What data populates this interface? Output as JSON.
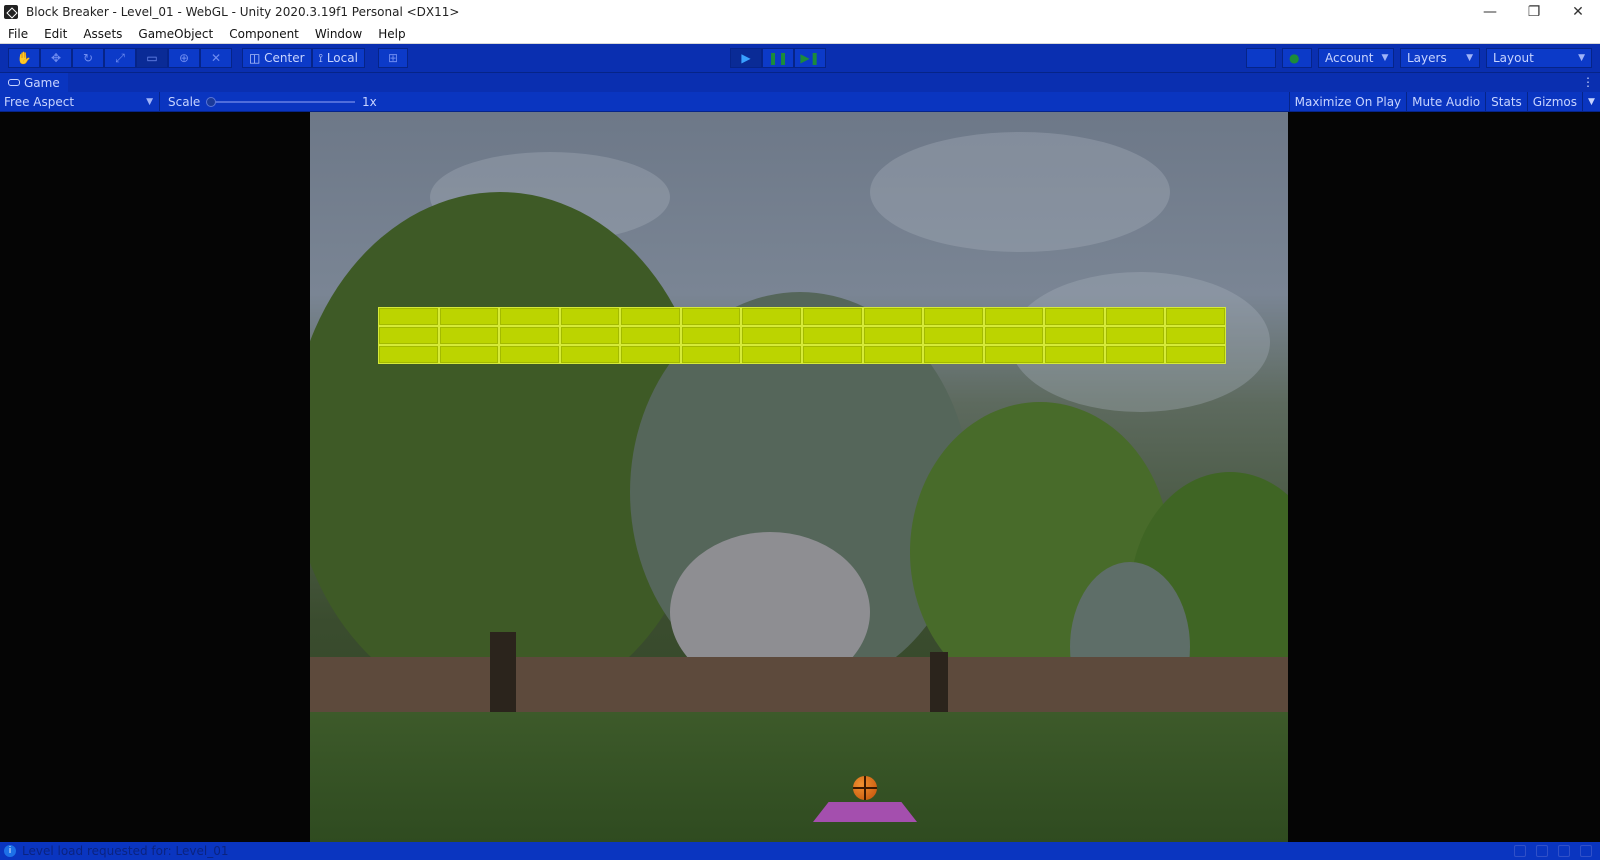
{
  "window": {
    "title": "Block Breaker - Level_01 - WebGL - Unity 2020.3.19f1 Personal <DX11>",
    "controls": [
      "—",
      "❐",
      "✕"
    ]
  },
  "menu": [
    "File",
    "Edit",
    "Assets",
    "GameObject",
    "Component",
    "Window",
    "Help"
  ],
  "toolbar": {
    "tools": [
      "hand-tool",
      "move-tool",
      "rotate-tool",
      "scale-tool",
      "rect-tool",
      "transform-tool",
      "custom-tool"
    ],
    "pivot_label": "Center",
    "space_label": "Local",
    "play_controls": [
      "play",
      "pause",
      "step"
    ],
    "account_label": "Account",
    "layers_label": "Layers",
    "layout_label": "Layout"
  },
  "game_tab": {
    "label": "Game",
    "aspect": "Free Aspect",
    "scale_label": "Scale",
    "scale_value": "1x",
    "scale_fraction": 0,
    "maximize_label": "Maximize On Play",
    "mute_label": "Mute Audio",
    "stats_label": "Stats",
    "gizmos_label": "Gizmos"
  },
  "game": {
    "brick_rows": 3,
    "brick_columns": 14,
    "brick_color": "#bcd400",
    "paddle_color": "#a44fae",
    "ball_color": "#e0701a"
  },
  "status": {
    "message": "Level load requested for: Level_01"
  },
  "colors": {
    "editor_accent": "#0a2fb0",
    "titlebar": "#ffffff"
  }
}
